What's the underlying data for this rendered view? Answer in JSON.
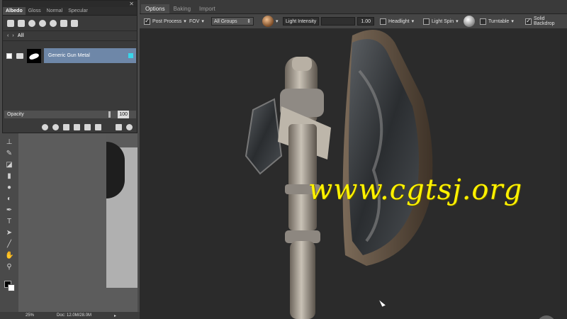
{
  "left_panel": {
    "channel_tabs": [
      "Albedo",
      "Gloss",
      "Normal",
      "Specular"
    ],
    "breadcrumb": "All",
    "material": {
      "name": "Generic Gun Metal",
      "swatch_color": "#38d6ea"
    },
    "opacity": {
      "label": "Opacity",
      "value": "100"
    }
  },
  "status_bar": {
    "zoom": "25%",
    "doc": "Doc: 12.0M/28.0M"
  },
  "viewer": {
    "tabs": [
      "Options",
      "Baking",
      "Import"
    ],
    "active_tab": "Options",
    "toolbar": {
      "post_process": "Post Process",
      "fov": "FOV",
      "groups": "All Groups",
      "light_intensity_label": "Light Intensity",
      "light_intensity_value": "1.00",
      "headlight": "Headlight",
      "light_spin": "Light Spin",
      "turntable": "Turntable",
      "solid_backdrop": "Solid Backdrop"
    }
  },
  "watermark": "www.cgtsj.org",
  "colors": {
    "selection": "#6e87a8",
    "watermark": "#fff200",
    "viewer_bg": "#2b2b2b"
  }
}
